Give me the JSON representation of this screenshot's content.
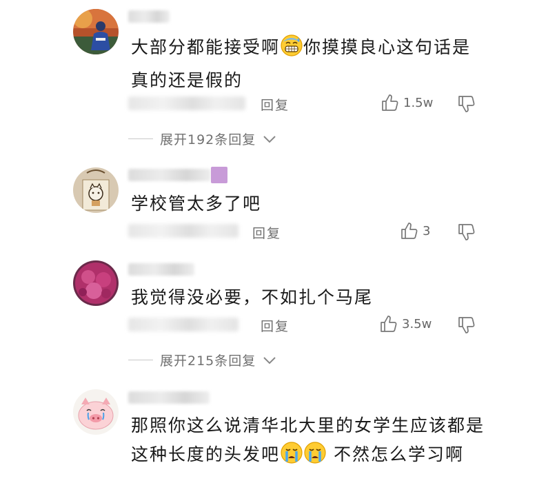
{
  "comments": [
    {
      "text_a": "大部分都能接受啊",
      "emoji_a": "sweat-smile-emoji",
      "text_b": "你摸摸良心这句话是真的还是假的",
      "reply_label": "回复",
      "likes": "1.5w",
      "expand_label": "展开192条回复"
    },
    {
      "text_a": "学校管太多了吧",
      "reply_label": "回复",
      "likes": "3"
    },
    {
      "text_a": "我觉得没必要，不如扎个马尾",
      "reply_label": "回复",
      "likes": "3.5w",
      "expand_label": "展开215条回复"
    },
    {
      "text_a": "那照你这么说清华北大里的女学生应该都是这种长度的头发吧",
      "emoji_a": "crying-emoji",
      "text_b": " 不然怎么学习啊"
    }
  ],
  "colors": {
    "text": "#1a1a1a",
    "meta": "#6f6f6f",
    "icon": "#777777",
    "purple_tag": "#c89bd8"
  }
}
